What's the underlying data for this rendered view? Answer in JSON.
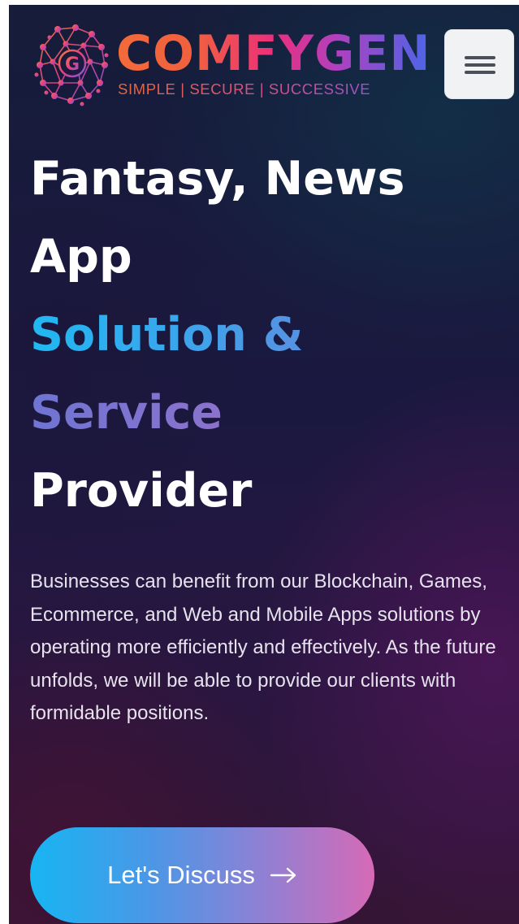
{
  "header": {
    "logo": {
      "letter": "G",
      "name": "COMFYGEN",
      "tagline": "SIMPLE | SECURE | SUCCESSIVE"
    },
    "menu_icon": "hamburger-menu-icon"
  },
  "hero": {
    "title_lines": [
      "Fantasy, News",
      "App",
      "Solution &",
      "Service",
      "Provider"
    ],
    "description": "Businesses can benefit from our Blockchain, Games, Ecommerce, and Web and Mobile Apps solutions by operating more efficiently and effectively. As the future unfolds, we will be able to provide our clients with formidable positions.",
    "cta_label": "Let's Discuss",
    "cta_icon": "arrow-right-icon"
  },
  "colors": {
    "brand_orange": "#f26b3a",
    "brand_pink": "#ec2f7c",
    "brand_purple": "#b040c0",
    "brand_blue": "#4a66e8",
    "accent_cyan": "#21b6f1",
    "accent_magenta": "#d66ab6",
    "background_navy": "#1b1840",
    "menu_button_bg": "#f1f2f4"
  }
}
